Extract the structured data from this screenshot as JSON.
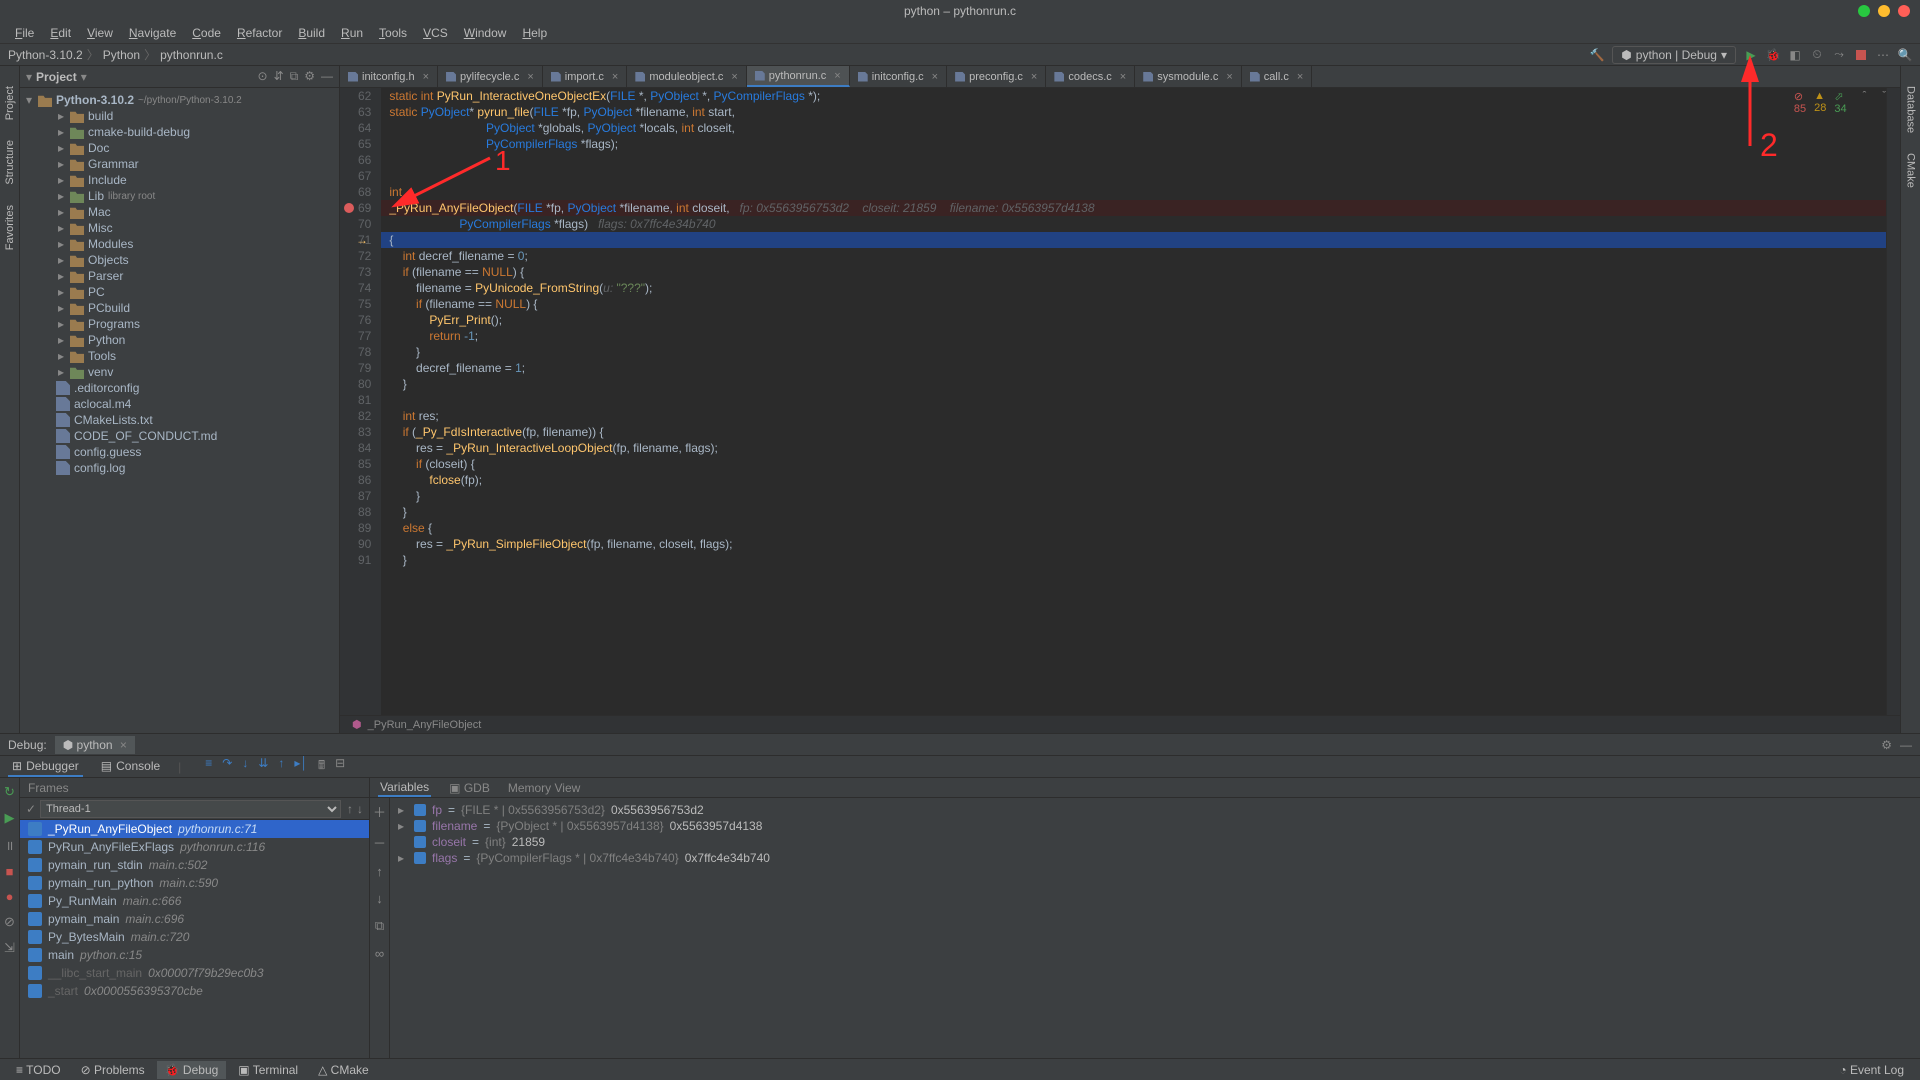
{
  "windowTitle": "python – pythonrun.c",
  "menu": [
    "File",
    "Edit",
    "View",
    "Navigate",
    "Code",
    "Refactor",
    "Build",
    "Run",
    "Tools",
    "VCS",
    "Window",
    "Help"
  ],
  "breadcrumb": [
    "Python-3.10.2",
    "Python",
    "pythonrun.c"
  ],
  "runConfig": "python | Debug",
  "projectHeader": "Project",
  "projectRoot": {
    "name": "Python-3.10.2",
    "path": "~/python/Python-3.10.2"
  },
  "projectTree": [
    {
      "name": "build",
      "t": "folder",
      "d": 2
    },
    {
      "name": "cmake-build-debug",
      "t": "folder-o",
      "d": 2
    },
    {
      "name": "Doc",
      "t": "folder",
      "d": 2
    },
    {
      "name": "Grammar",
      "t": "folder",
      "d": 2
    },
    {
      "name": "Include",
      "t": "folder",
      "d": 2
    },
    {
      "name": "Lib",
      "t": "folder-o",
      "d": 2,
      "suffix": "library root"
    },
    {
      "name": "Mac",
      "t": "folder",
      "d": 2
    },
    {
      "name": "Misc",
      "t": "folder",
      "d": 2
    },
    {
      "name": "Modules",
      "t": "folder",
      "d": 2
    },
    {
      "name": "Objects",
      "t": "folder",
      "d": 2
    },
    {
      "name": "Parser",
      "t": "folder",
      "d": 2
    },
    {
      "name": "PC",
      "t": "folder",
      "d": 2
    },
    {
      "name": "PCbuild",
      "t": "folder",
      "d": 2
    },
    {
      "name": "Programs",
      "t": "folder",
      "d": 2
    },
    {
      "name": "Python",
      "t": "folder",
      "d": 2
    },
    {
      "name": "Tools",
      "t": "folder",
      "d": 2
    },
    {
      "name": "venv",
      "t": "folder-o",
      "d": 2
    },
    {
      "name": ".editorconfig",
      "t": "file",
      "d": 2
    },
    {
      "name": "aclocal.m4",
      "t": "file",
      "d": 2
    },
    {
      "name": "CMakeLists.txt",
      "t": "file",
      "d": 2
    },
    {
      "name": "CODE_OF_CONDUCT.md",
      "t": "file",
      "d": 2
    },
    {
      "name": "config.guess",
      "t": "file",
      "d": 2
    },
    {
      "name": "config.log",
      "t": "file",
      "d": 2
    }
  ],
  "tabs": [
    {
      "label": "initconfig.h"
    },
    {
      "label": "pylifecycle.c"
    },
    {
      "label": "import.c"
    },
    {
      "label": "moduleobject.c"
    },
    {
      "label": "pythonrun.c",
      "active": true
    },
    {
      "label": "initconfig.c"
    },
    {
      "label": "preconfig.c"
    },
    {
      "label": "codecs.c"
    },
    {
      "label": "sysmodule.c"
    },
    {
      "label": "call.c"
    }
  ],
  "code": {
    "startLine": 62,
    "lines": [
      {
        "n": 62,
        "h": "<span class='kw'>static</span> <span class='kw'>int</span> <span class='fn'>PyRun_InteractiveOneObjectEx</span>(<span class='tt'>FILE</span> *, <span class='tt'>PyObject</span> *, <span class='tt'>PyCompilerFlags</span> *);"
      },
      {
        "n": 63,
        "h": "<span class='kw'>static</span> <span class='tt'>PyObject</span>* <span class='fn'>pyrun_file</span>(<span class='tt'>FILE</span> *fp, <span class='tt'>PyObject</span> *filename, <span class='kw'>int</span> start,"
      },
      {
        "n": 64,
        "h": "                             <span class='tt'>PyObject</span> *globals, <span class='tt'>PyObject</span> *locals, <span class='kw'>int</span> closeit,"
      },
      {
        "n": 65,
        "h": "                             <span class='tt'>PyCompilerFlags</span> *flags);"
      },
      {
        "n": 66,
        "h": ""
      },
      {
        "n": 67,
        "h": ""
      },
      {
        "n": 68,
        "h": "<span class='kw'>int</span>"
      },
      {
        "n": 69,
        "bp": true,
        "cls": "hl-bp",
        "h": "<span class='fn'>_PyRun_AnyFileObject</span>(<span class='tt'>FILE</span> *fp, <span class='tt'>PyObject</span> *filename, <span class='kw'>int</span> closeit,   <span class='hint'>fp: 0x5563956753d2    closeit: 21859    filename: 0x5563957d4138</span>"
      },
      {
        "n": 70,
        "h": "                     <span class='tt'>PyCompilerFlags</span> *flags)   <span class='hint'>flags: 0x7ffc4e34b740</span>"
      },
      {
        "n": 71,
        "arrow": true,
        "cls": "hl-cur",
        "h": "{"
      },
      {
        "n": 72,
        "h": "    <span class='kw'>int</span> decref_filename = <span class='num'>0</span>;"
      },
      {
        "n": 73,
        "h": "    <span class='kw'>if</span> (filename == <span class='null'>NULL</span>) {"
      },
      {
        "n": 74,
        "h": "        filename = <span class='fn'>PyUnicode_FromString</span>(<span class='hint'>u:</span> <span class='str'>\"???\"</span>);"
      },
      {
        "n": 75,
        "h": "        <span class='kw'>if</span> (filename == <span class='null'>NULL</span>) {"
      },
      {
        "n": 76,
        "h": "            <span class='fn'>PyErr_Print</span>();"
      },
      {
        "n": 77,
        "h": "            <span class='kw'>return</span> <span class='num'>-1</span>;"
      },
      {
        "n": 78,
        "h": "        }"
      },
      {
        "n": 79,
        "h": "        decref_filename = <span class='num'>1</span>;"
      },
      {
        "n": 80,
        "h": "    }"
      },
      {
        "n": 81,
        "h": ""
      },
      {
        "n": 82,
        "h": "    <span class='kw'>int</span> res;"
      },
      {
        "n": 83,
        "h": "    <span class='kw'>if</span> (<span class='fn'>_Py_FdIsInteractive</span>(fp, filename)) {"
      },
      {
        "n": 84,
        "h": "        res = <span class='fn'>_PyRun_InteractiveLoopObject</span>(fp, filename, flags);"
      },
      {
        "n": 85,
        "h": "        <span class='kw'>if</span> (closeit) {"
      },
      {
        "n": 86,
        "h": "            <span class='fn'>fclose</span>(fp);"
      },
      {
        "n": 87,
        "h": "        }"
      },
      {
        "n": 88,
        "h": "    }"
      },
      {
        "n": 89,
        "h": "    <span class='kw'>else</span> {"
      },
      {
        "n": 90,
        "h": "        res = <span class='fn'>_PyRun_SimpleFileObject</span>(fp, filename, closeit, flags);"
      },
      {
        "n": 91,
        "h": "    }"
      }
    ]
  },
  "codeBreadcrumb": "_PyRun_AnyFileObject",
  "errCounts": {
    "errors": "85",
    "warnings": "28",
    "weak": "34"
  },
  "debugLabel": "Debug:",
  "debugRunConfig": "python",
  "debugSubtabs": {
    "debugger": "Debugger",
    "console": "Console",
    "gdb": "GDB",
    "memory": "Memory View"
  },
  "framesLabel": "Frames",
  "variablesLabel": "Variables",
  "thread": "Thread-1",
  "frames": [
    {
      "fn": "_PyRun_AnyFileObject",
      "loc": "pythonrun.c:71",
      "sel": true
    },
    {
      "fn": "PyRun_AnyFileExFlags",
      "loc": "pythonrun.c:116"
    },
    {
      "fn": "pymain_run_stdin",
      "loc": "main.c:502"
    },
    {
      "fn": "pymain_run_python",
      "loc": "main.c:590"
    },
    {
      "fn": "Py_RunMain",
      "loc": "main.c:666"
    },
    {
      "fn": "pymain_main",
      "loc": "main.c:696"
    },
    {
      "fn": "Py_BytesMain",
      "loc": "main.c:720"
    },
    {
      "fn": "main",
      "loc": "python.c:15"
    },
    {
      "fn": "__libc_start_main",
      "loc": "0x00007f79b29ec0b3",
      "dim": true
    },
    {
      "fn": "_start",
      "loc": "0x0000556395370cbe",
      "dim": true
    }
  ],
  "variables": [
    {
      "name": "fp",
      "type": "{FILE * | 0x5563956753d2}",
      "val": "0x5563956753d2",
      "exp": true
    },
    {
      "name": "filename",
      "type": "{PyObject * | 0x5563957d4138}",
      "val": "0x5563957d4138",
      "exp": true
    },
    {
      "name": "closeit",
      "type": "{int}",
      "val": "21859"
    },
    {
      "name": "flags",
      "type": "{PyCompilerFlags * | 0x7ffc4e34b740}",
      "val": "0x7ffc4e34b740",
      "exp": true
    }
  ],
  "bottomTabs": [
    {
      "label": "TODO",
      "icon": "≡"
    },
    {
      "label": "Problems",
      "icon": "⊘"
    },
    {
      "label": "Debug",
      "icon": "🐞",
      "active": true
    },
    {
      "label": "Terminal",
      "icon": "▣"
    },
    {
      "label": "CMake",
      "icon": "△"
    }
  ],
  "eventLog": "Event Log",
  "leftGutter": [
    "Project",
    "Structure",
    "Favorites"
  ],
  "rightGutter": [
    "Database",
    "CMake"
  ]
}
